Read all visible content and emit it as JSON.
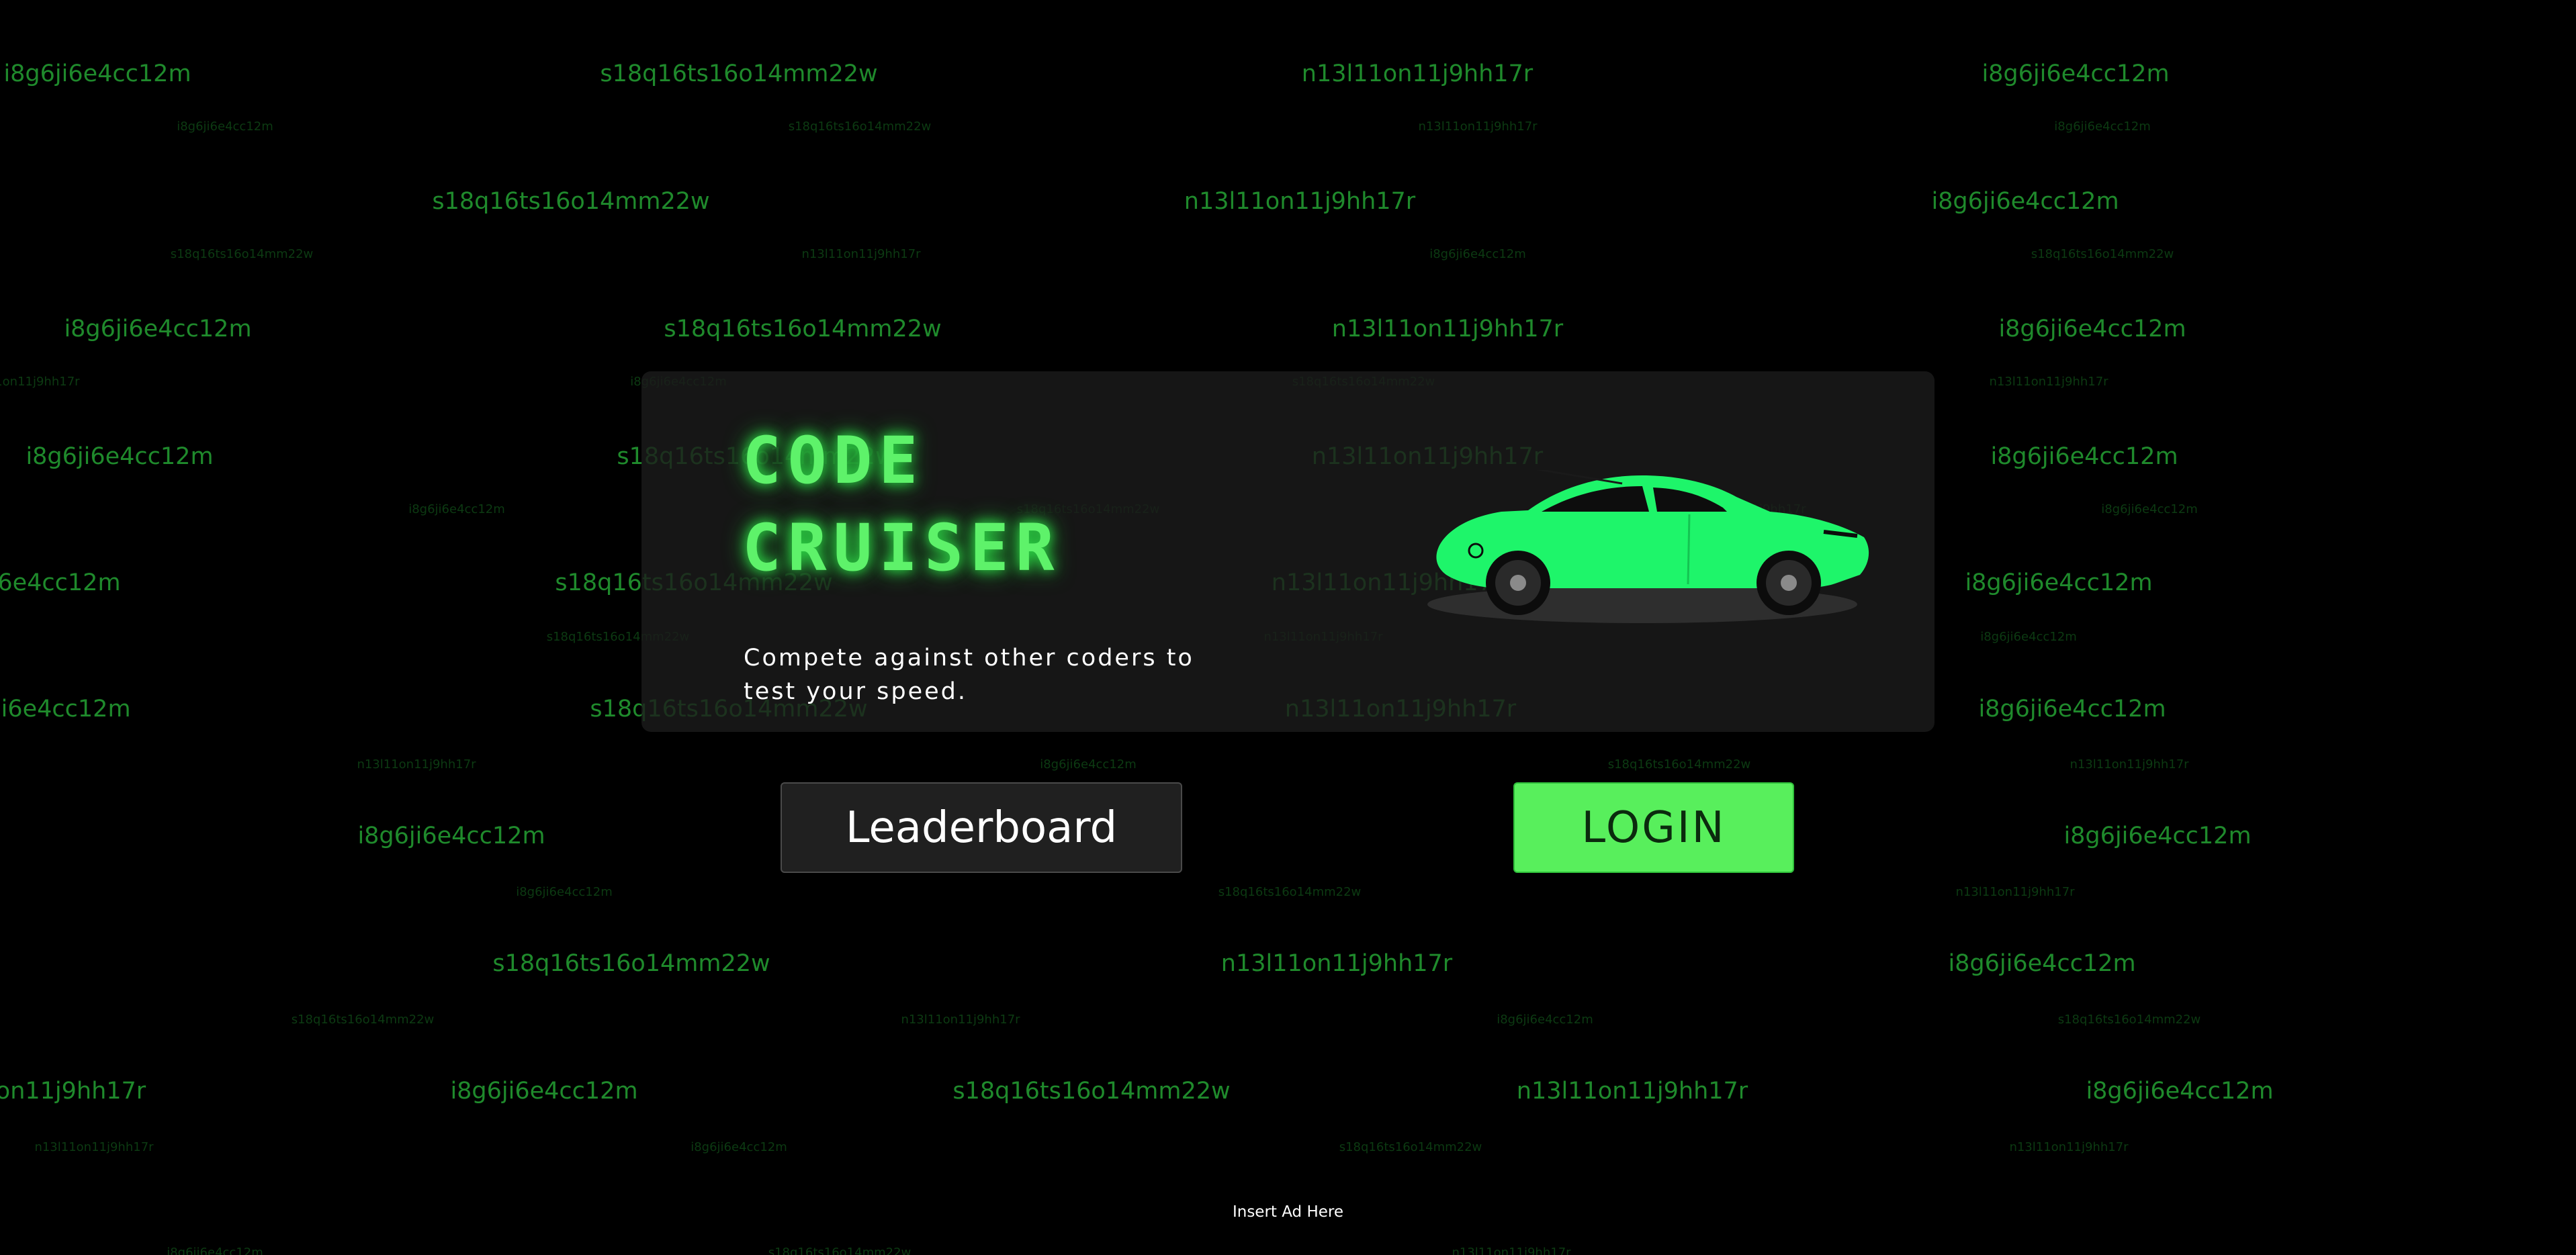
{
  "background": {
    "tokens": [
      "i8g6ji6e4cc12m",
      "s18q16ts16o14mm22w",
      "n13l11on11j9hh17r"
    ],
    "text_color": "#1f8a2c",
    "dim_text_color": "#0c3a12"
  },
  "hero": {
    "title_line_1": "CODE",
    "title_line_2": "CRUISER",
    "tagline": "Compete against other coders to test your speed.",
    "car_icon": "sports-car-icon",
    "title_color": "#5ef26a"
  },
  "buttons": {
    "leaderboard_label": "Leaderboard",
    "login_label": "LOGIN",
    "login_color": "#58ef5c"
  },
  "footer": {
    "ad_text": "Insert Ad Here"
  }
}
